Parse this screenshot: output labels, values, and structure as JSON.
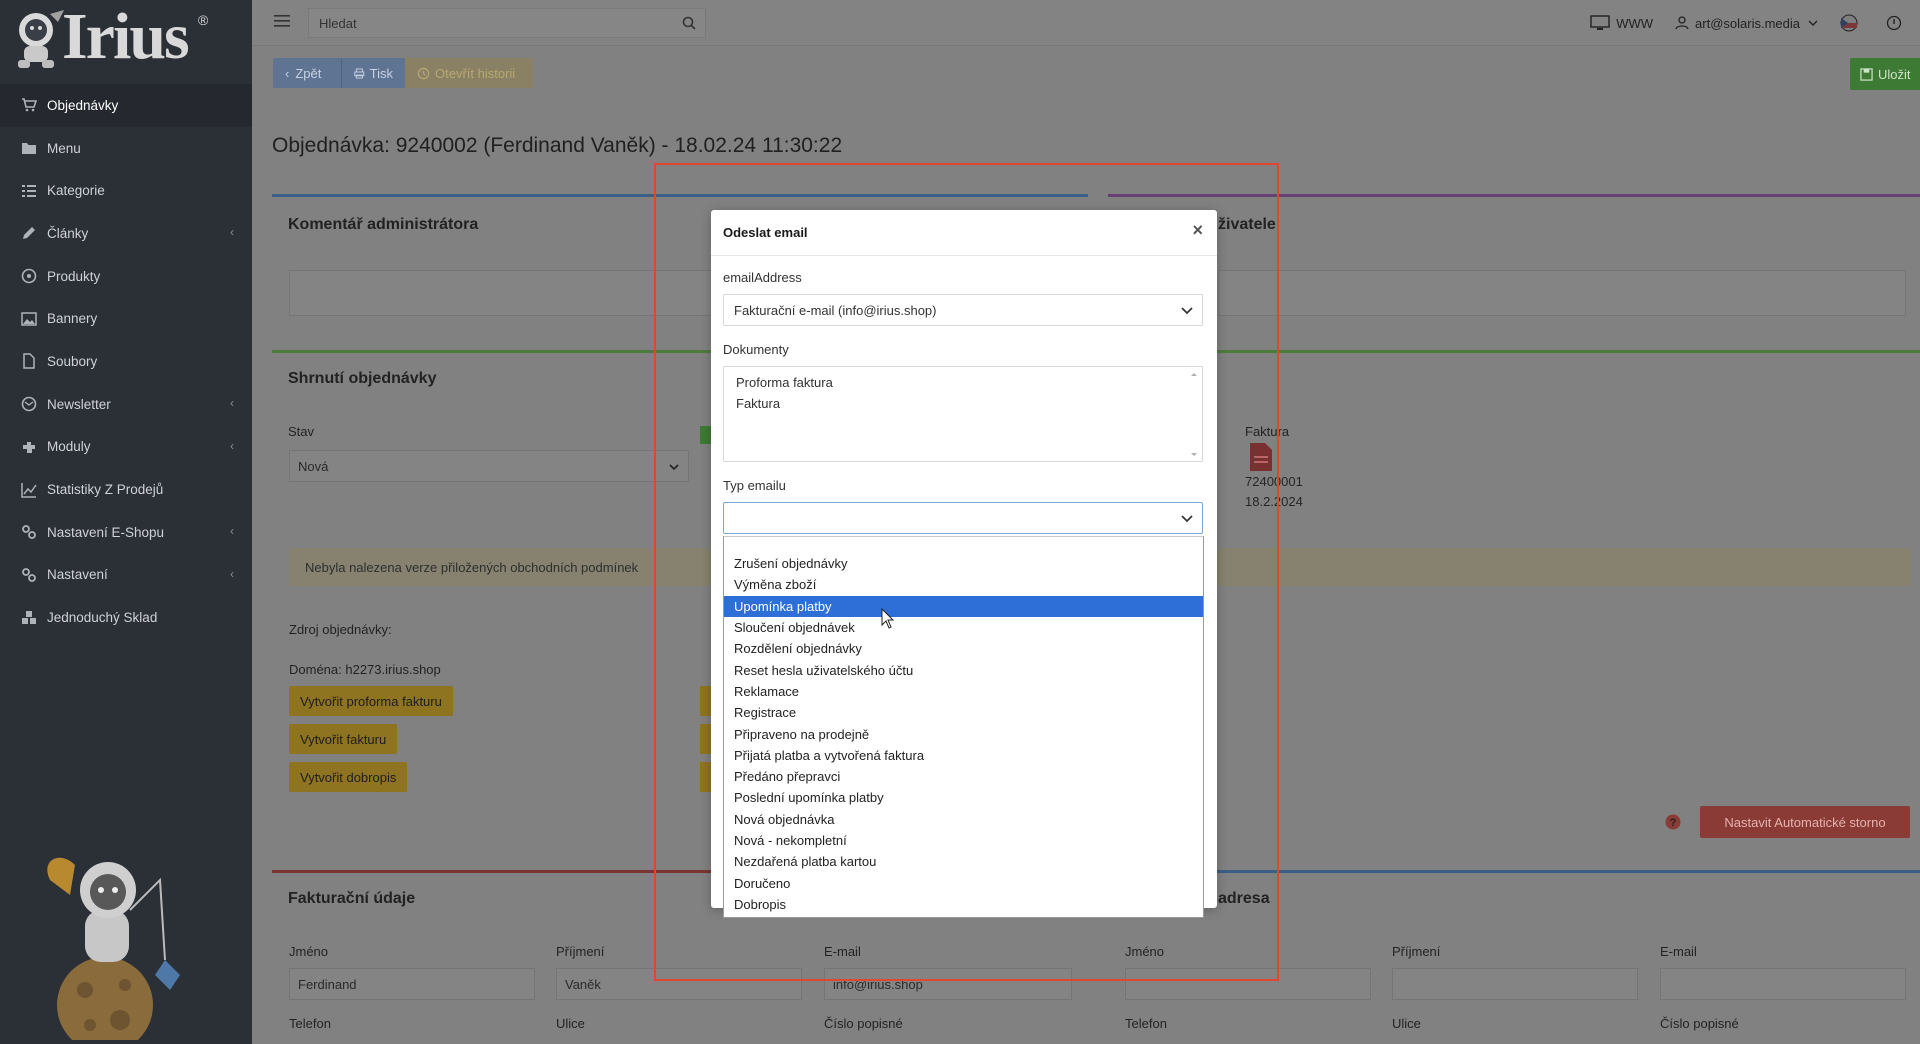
{
  "brand": {
    "name": "Irius",
    "reg": "®"
  },
  "topbar": {
    "search_placeholder": "Hledat",
    "www_label": "WWW",
    "user_email": "art@solaris.media"
  },
  "toolbar": {
    "back_label": "Zpět",
    "print_label": "Tisk",
    "history_label": "Otevřít historii",
    "save_label": "Uložit"
  },
  "sidebar": {
    "items": [
      {
        "label": "Objednávky",
        "icon": "cart-icon",
        "active": true,
        "has_submenu": false
      },
      {
        "label": "Menu",
        "icon": "folder-icon",
        "active": false,
        "has_submenu": false
      },
      {
        "label": "Kategorie",
        "icon": "list-icon",
        "active": false,
        "has_submenu": false
      },
      {
        "label": "Články",
        "icon": "pencil-icon",
        "active": false,
        "has_submenu": true
      },
      {
        "label": "Produkty",
        "icon": "cube-icon",
        "active": false,
        "has_submenu": false
      },
      {
        "label": "Bannery",
        "icon": "image-icon",
        "active": false,
        "has_submenu": false
      },
      {
        "label": "Soubory",
        "icon": "file-icon",
        "active": false,
        "has_submenu": false
      },
      {
        "label": "Newsletter",
        "icon": "mail-icon",
        "active": false,
        "has_submenu": true
      },
      {
        "label": "Moduly",
        "icon": "puzzle-icon",
        "active": false,
        "has_submenu": true
      },
      {
        "label": "Statistiky Z Prodejů",
        "icon": "chart-icon",
        "active": false,
        "has_submenu": false
      },
      {
        "label": "Nastavení E-Shopu",
        "icon": "cogs-icon",
        "active": false,
        "has_submenu": true
      },
      {
        "label": "Nastavení",
        "icon": "cogs-icon",
        "active": false,
        "has_submenu": true
      },
      {
        "label": "Jednoduchý Sklad",
        "icon": "boxes-icon",
        "active": false,
        "has_submenu": false
      }
    ]
  },
  "page": {
    "title": "Objednávka: 9240002 (Ferdinand Vaněk) - 18.02.24 11:30:22"
  },
  "admin_comment": {
    "title": "Komentář administrátora"
  },
  "user_comment": {
    "title_suffix": "živatele"
  },
  "summary": {
    "title": "Shrnutí objednávky",
    "status_label": "Stav",
    "status_value": "Nová",
    "invoice_label": "Faktura",
    "invoice_number": "72400001",
    "invoice_date": "18.2.2024",
    "warning": "Nebyla nalezena verze přiložených obchodních podmínek",
    "source_label": "Zdroj objednávky:",
    "domain_label": "Doména: h2273.irius.shop",
    "btn_proforma": "Vytvořit proforma fakturu",
    "btn_invoice": "Vytvořit fakturu",
    "btn_credit": "Vytvořit dobropis",
    "btn_auto_storno": "Nastavit Automatické storno"
  },
  "billing": {
    "title": "Fakturační údaje",
    "first_name_label": "Jméno",
    "first_name_value": "Ferdinand",
    "last_name_label": "Příjmení",
    "last_name_value": "Vaněk",
    "email_label": "E-mail",
    "email_value": "info@irius.shop",
    "phone_label": "Telefon",
    "street_label": "Ulice",
    "house_label": "Číslo popisné"
  },
  "shipping": {
    "title_suffix": "adresa",
    "first_name_label": "Jméno",
    "last_name_label": "Příjmení",
    "email_label": "E-mail",
    "phone_label": "Telefon",
    "street_label": "Ulice",
    "house_label": "Číslo popisné"
  },
  "modal": {
    "title": "Odeslat email",
    "close": "×",
    "email_address_label": "emailAddress",
    "email_address_value": "Fakturační e-mail (info@irius.shop)",
    "documents_label": "Dokumenty",
    "documents": [
      "Proforma faktura",
      "Faktura"
    ],
    "email_type_label": "Typ emailu",
    "email_type_value": "",
    "email_type_options": [
      "Zrušení objednávky",
      "Výměna zboží",
      "Upomínka platby",
      "Sloučení objednávek",
      "Rozdělení objednávky",
      "Reset hesla uživatelského účtu",
      "Reklamace",
      "Registrace",
      "Připraveno na prodejně",
      "Přijatá platba a vytvořená faktura",
      "Předáno přepravci",
      "Poslední upomínka platby",
      "Nová objednávka",
      "Nová - nekompletní",
      "Nezdařená platba kartou",
      "Doručeno",
      "Dobropis"
    ],
    "highlighted_option_index": 2
  },
  "colors": {
    "sidebar_bg": "#2b2f36",
    "selected_option": "#2d6fd6",
    "annotation_frame": "#e0472d"
  }
}
